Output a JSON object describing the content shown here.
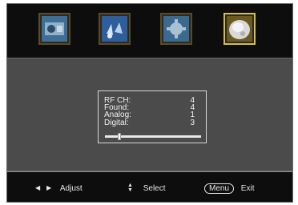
{
  "tabs": [
    {
      "name": "picture-tab",
      "icon": "picture-settings-icon"
    },
    {
      "name": "sound-tab",
      "icon": "sound-settings-icon"
    },
    {
      "name": "setup-tab",
      "icon": "gear-settings-icon"
    },
    {
      "name": "channel-tab",
      "icon": "channel-scan-icon",
      "active": true
    }
  ],
  "scan": {
    "rows": [
      {
        "label": "RF  CH:",
        "value": "4"
      },
      {
        "label": "Found:",
        "value": "4"
      },
      {
        "label": "Analog:",
        "value": "1"
      },
      {
        "label": "Digital:",
        "value": "3"
      }
    ],
    "progress": 0.14
  },
  "footer": {
    "adjust_label": "Adjust",
    "select_label": "Select",
    "menu_key": "Menu",
    "exit_label": "Exit"
  },
  "colors": {
    "accent": "#d4bd4a",
    "panel": "#4b4b4b",
    "background": "#0d0d0d"
  }
}
